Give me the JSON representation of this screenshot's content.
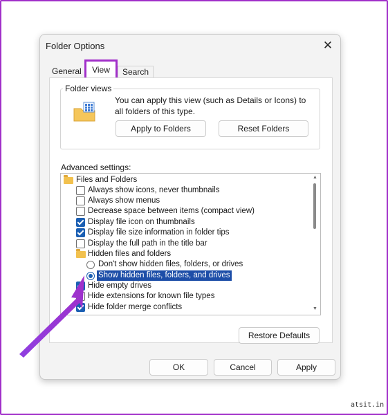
{
  "dialog": {
    "title": "Folder Options",
    "close_icon": "close-icon",
    "tabs": [
      {
        "label": "General",
        "selected": false
      },
      {
        "label": "View",
        "selected": true
      },
      {
        "label": "Search",
        "selected": false
      }
    ]
  },
  "folder_views": {
    "legend": "Folder views",
    "description": "You can apply this view (such as Details or Icons) to all folders of this type.",
    "icon": "folder-view-icon",
    "apply_button": "Apply to Folders",
    "reset_button": "Reset Folders"
  },
  "advanced": {
    "label": "Advanced settings:",
    "items": [
      {
        "kind": "folder",
        "label": "Files and Folders"
      },
      {
        "kind": "checkbox",
        "checked": false,
        "label": "Always show icons, never thumbnails"
      },
      {
        "kind": "checkbox",
        "checked": false,
        "label": "Always show menus"
      },
      {
        "kind": "checkbox",
        "checked": false,
        "label": "Decrease space between items (compact view)"
      },
      {
        "kind": "checkbox",
        "checked": true,
        "label": "Display file icon on thumbnails"
      },
      {
        "kind": "checkbox",
        "checked": true,
        "label": "Display file size information in folder tips"
      },
      {
        "kind": "checkbox",
        "checked": false,
        "label": "Display the full path in the title bar"
      },
      {
        "kind": "folder",
        "label": "Hidden files and folders"
      },
      {
        "kind": "radio",
        "checked": false,
        "label": "Don't show hidden files, folders, or drives"
      },
      {
        "kind": "radio",
        "checked": true,
        "label": "Show hidden files, folders, and drives"
      },
      {
        "kind": "checkbox",
        "checked": true,
        "label": "Hide empty drives"
      },
      {
        "kind": "checkbox",
        "checked": false,
        "label": "Hide extensions for known file types"
      },
      {
        "kind": "checkbox",
        "checked": true,
        "label": "Hide folder merge conflicts"
      }
    ]
  },
  "restore_defaults_button": "Restore Defaults",
  "footer": {
    "ok": "OK",
    "cancel": "Cancel",
    "apply": "Apply"
  },
  "colors": {
    "highlight_border": "#a12fc9",
    "arrow": "#a12fc9",
    "selection": "#1d4ea8",
    "check": "#1b5fb3"
  },
  "watermark": "atsit.in"
}
